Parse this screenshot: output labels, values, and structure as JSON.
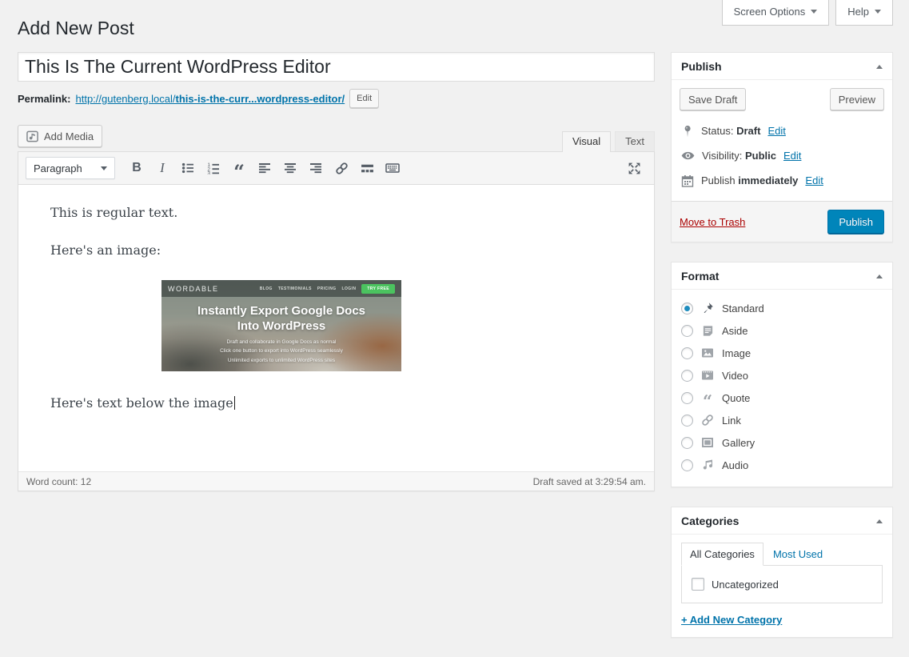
{
  "page": {
    "title": "Add New Post"
  },
  "top_bar": {
    "screen_options_label": "Screen Options",
    "help_label": "Help"
  },
  "post": {
    "title_value": "This Is The Current WordPress Editor"
  },
  "permalink": {
    "label": "Permalink:",
    "url_base": "http://gutenberg.local/",
    "url_slug": "this-is-the-curr...wordpress-editor/",
    "edit_label": "Edit"
  },
  "editor": {
    "add_media_label": "Add Media",
    "tabs": {
      "visual": "Visual",
      "text": "Text"
    },
    "toolbar": {
      "paragraph_label": "Paragraph",
      "icon_names": [
        "bold-icon",
        "italic-icon",
        "bulleted-list-icon",
        "numbered-list-icon",
        "blockquote-icon",
        "align-left-icon",
        "align-center-icon",
        "align-right-icon",
        "link-icon",
        "read-more-icon",
        "keyboard-toggle-icon",
        "fullscreen-icon"
      ]
    },
    "content": {
      "paragraph1": "This is regular text.",
      "paragraph2": "Here's an image:",
      "paragraph3": "Here's text below the image"
    },
    "statusbar": {
      "word_count": "Word count: 12",
      "draft_saved": "Draft saved at 3:29:54 am."
    }
  },
  "embedded_image": {
    "logo": "WORDABLE",
    "nav": [
      "BLOG",
      "TESTIMONIALS",
      "PRICING",
      "LOGIN"
    ],
    "cta_label": "TRY FREE",
    "heading_line1": "Instantly Export Google Docs",
    "heading_line2": "Into WordPress",
    "subtext": [
      "Draft and collaborate in Google Docs as normal",
      "Click one button to export into WordPress seamlessly",
      "Unlimited exports to unlimited WordPress sites"
    ]
  },
  "publish_box": {
    "title": "Publish",
    "save_draft_label": "Save Draft",
    "preview_label": "Preview",
    "status_label": "Status:",
    "status_value": "Draft",
    "visibility_label": "Visibility:",
    "visibility_value": "Public",
    "schedule_label": "Publish",
    "schedule_value": "immediately",
    "edit_label": "Edit",
    "move_to_trash_label": "Move to Trash",
    "publish_button_label": "Publish"
  },
  "format_box": {
    "title": "Format",
    "options": [
      {
        "label": "Standard",
        "selected": true,
        "icon": "pushpin-icon"
      },
      {
        "label": "Aside",
        "selected": false,
        "icon": "aside-icon"
      },
      {
        "label": "Image",
        "selected": false,
        "icon": "image-icon"
      },
      {
        "label": "Video",
        "selected": false,
        "icon": "video-icon"
      },
      {
        "label": "Quote",
        "selected": false,
        "icon": "quote-icon"
      },
      {
        "label": "Link",
        "selected": false,
        "icon": "link-icon"
      },
      {
        "label": "Gallery",
        "selected": false,
        "icon": "gallery-icon"
      },
      {
        "label": "Audio",
        "selected": false,
        "icon": "audio-icon"
      }
    ]
  },
  "categories_box": {
    "title": "Categories",
    "tab_all": "All Categories",
    "tab_most_used": "Most Used",
    "items": [
      {
        "label": "Uncategorized",
        "checked": false
      }
    ],
    "add_new_label": "+ Add New Category"
  },
  "colors": {
    "accent_link": "#0073aa",
    "primary_button": "#0085ba",
    "trash_link": "#aa0000",
    "cta_green": "#4bc35f",
    "page_background": "#f1f1f1"
  }
}
